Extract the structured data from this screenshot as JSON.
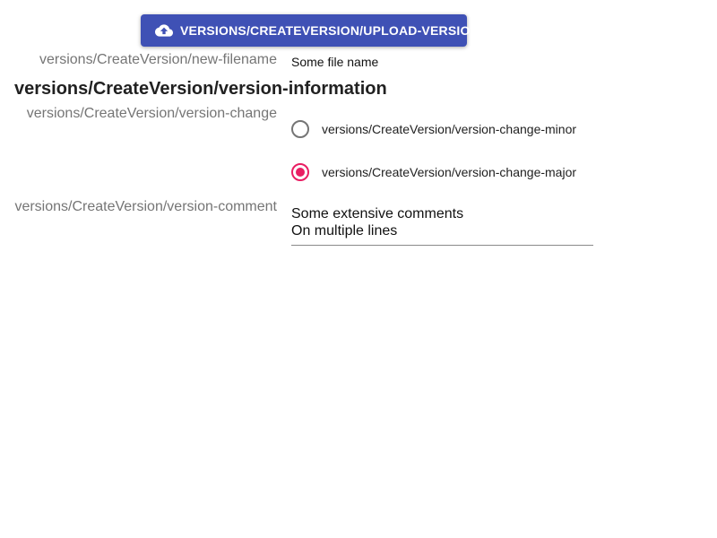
{
  "upload_button": {
    "label": "VERSIONS/CREATEVERSION/UPLOAD-VERSION",
    "icon": "cloud-upload-icon",
    "color": "#3f51b5"
  },
  "filename": {
    "label": "versions/CreateVersion/new-filename",
    "value": "Some file name"
  },
  "version_information": {
    "heading": "versions/CreateVersion/version-information"
  },
  "version_change": {
    "label": "versions/CreateVersion/version-change",
    "options": [
      {
        "label": "versions/CreateVersion/version-change-minor",
        "selected": false
      },
      {
        "label": "versions/CreateVersion/version-change-major",
        "selected": true
      }
    ],
    "accent_color": "#e91e63"
  },
  "version_comment": {
    "label": "versions/CreateVersion/version-comment",
    "lines": [
      "Some extensive comments",
      "On multiple lines"
    ]
  }
}
